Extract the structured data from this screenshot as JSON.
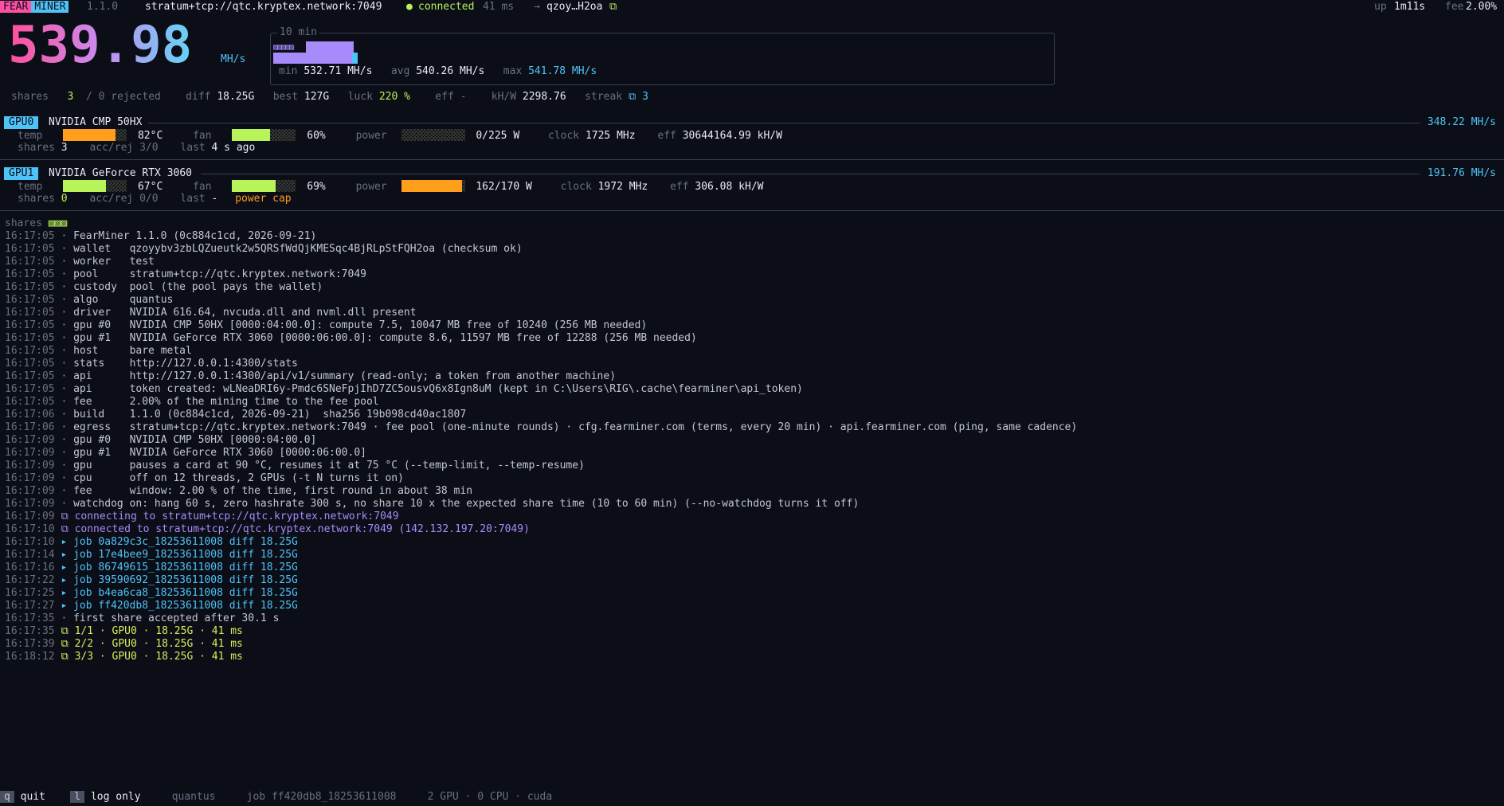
{
  "top": {
    "brand1": "FEAR",
    "brand2": "MINER",
    "version": "1.1.0",
    "pool": "stratum+tcp://qtc.kryptex.network:7049",
    "dot": "●",
    "status": "connected",
    "latency": "41 ms",
    "arrow": "→",
    "wallet_short": "qzoy…H2oa",
    "wallet_icon": "⧉",
    "uptime_label": "up",
    "uptime": "1m11s",
    "fee_label": "fee",
    "fee": "2.00%"
  },
  "hashrate": {
    "value": "539.98",
    "unit": "MH/s"
  },
  "spark": {
    "title": "10 min",
    "chips": "▨▨▨▨▨",
    "chip_end": "▨",
    "min_label": "min",
    "min": "532.71 MH/s",
    "avg_label": "avg",
    "avg": "540.26 MH/s",
    "max_label": "max",
    "max": "541.78 MH/s"
  },
  "summary": {
    "shares_label": "shares",
    "shares": "3",
    "rejected": "/ 0 rejected",
    "diff_label": "diff",
    "diff": "18.25G",
    "best_label": "best",
    "best": "127G",
    "luck_label": "luck",
    "luck": "220 %",
    "eff_label": "eff",
    "eff": "-",
    "khw_label": "kH/W",
    "khw": "2298.76",
    "streak_label": "streak",
    "streak_icon": "⧉",
    "streak": "3"
  },
  "gpus": [
    {
      "tag": "GPU0",
      "name": "NVIDIA CMP 50HX",
      "rate": "348.22 MH/s",
      "temp_label": "temp",
      "temp": "82°C",
      "temp_frac": 0.82,
      "temp_color": "#ff9f1c",
      "fan_label": "fan",
      "fan": "60%",
      "fan_frac": 0.6,
      "fan_color": "#b8f35a",
      "power_label": "power",
      "power": "0/225 W",
      "power_frac": 0.0,
      "power_color": "#ff9f1c",
      "clock_label": "clock",
      "clock": "1725 MHz",
      "eff_label": "eff",
      "eff": "30644164.99 kH/W",
      "shares_label": "shares",
      "shares": "3",
      "accrej_label": "acc/rej",
      "accrej": "3/0",
      "last_label": "last",
      "last": "4 s ago",
      "note": ""
    },
    {
      "tag": "GPU1",
      "name": "NVIDIA GeForce RTX 3060",
      "rate": "191.76 MH/s",
      "temp_label": "temp",
      "temp": "67°C",
      "temp_frac": 0.67,
      "temp_color": "#b8f35a",
      "fan_label": "fan",
      "fan": "69%",
      "fan_frac": 0.69,
      "fan_color": "#b8f35a",
      "power_label": "power",
      "power": "162/170 W",
      "power_frac": 0.95,
      "power_color": "#ff9f1c",
      "clock_label": "clock",
      "clock": "1972 MHz",
      "eff_label": "eff",
      "eff": "306.08 kH/W",
      "shares_label": "shares",
      "shares": "0",
      "accrej_label": "acc/rej",
      "accrej": "0/0",
      "last_label": "last",
      "last": "-",
      "note": "power cap"
    }
  ],
  "shares_strip": {
    "label": "shares",
    "marks": "▨▨▨"
  },
  "log": [
    {
      "t": "16:17:05",
      "s": "·",
      "k": "",
      "v": "FearMiner 1.1.0 (0c884c1cd, 2026-09-21)",
      "c": "#c3c7d3"
    },
    {
      "t": "16:17:05",
      "s": "·",
      "k": "wallet",
      "v": "qzoyybv3zbLQZueutk2w5QRSfWdQjKMESqc4BjRLpStFQH2oa (checksum ok)",
      "c": "#c3c7d3"
    },
    {
      "t": "16:17:05",
      "s": "·",
      "k": "worker",
      "v": "test",
      "c": "#c3c7d3"
    },
    {
      "t": "16:17:05",
      "s": "·",
      "k": "pool",
      "v": "stratum+tcp://qtc.kryptex.network:7049",
      "c": "#c3c7d3"
    },
    {
      "t": "16:17:05",
      "s": "·",
      "k": "custody",
      "v": "pool (the pool pays the wallet)",
      "c": "#c3c7d3"
    },
    {
      "t": "16:17:05",
      "s": "·",
      "k": "algo",
      "v": "quantus",
      "c": "#c3c7d3"
    },
    {
      "t": "16:17:05",
      "s": "·",
      "k": "driver",
      "v": "NVIDIA 616.64, nvcuda.dll and nvml.dll present",
      "c": "#c3c7d3"
    },
    {
      "t": "16:17:05",
      "s": "·",
      "k": "gpu #0",
      "v": "NVIDIA CMP 50HX [0000:04:00.0]: compute 7.5, 10047 MB free of 10240 (256 MB needed)",
      "c": "#c3c7d3"
    },
    {
      "t": "16:17:05",
      "s": "·",
      "k": "gpu #1",
      "v": "NVIDIA GeForce RTX 3060 [0000:06:00.0]: compute 8.6, 11597 MB free of 12288 (256 MB needed)",
      "c": "#c3c7d3"
    },
    {
      "t": "16:17:05",
      "s": "·",
      "k": "host",
      "v": "bare metal",
      "c": "#c3c7d3"
    },
    {
      "t": "16:17:05",
      "s": "·",
      "k": "stats",
      "v": "http://127.0.0.1:4300/stats",
      "c": "#c3c7d3"
    },
    {
      "t": "16:17:05",
      "s": "·",
      "k": "api",
      "v": "http://127.0.0.1:4300/api/v1/summary (read-only; a token from another machine)",
      "c": "#c3c7d3"
    },
    {
      "t": "16:17:05",
      "s": "·",
      "k": "api",
      "v": "token created: wLNeaDRI6y-Pmdc6SNeFpjIhD7ZC5ousvQ6x8Ign8uM (kept in C:\\Users\\RIG\\.cache\\fearminer\\api_token)",
      "c": "#c3c7d3"
    },
    {
      "t": "16:17:05",
      "s": "·",
      "k": "fee",
      "v": "2.00% of the mining time to the fee pool",
      "c": "#c3c7d3"
    },
    {
      "t": "16:17:06",
      "s": "·",
      "k": "build",
      "v": "1.1.0 (0c884c1cd, 2026-09-21)  sha256 19b098cd40ac1807",
      "c": "#c3c7d3"
    },
    {
      "t": "16:17:06",
      "s": "·",
      "k": "egress",
      "v": "stratum+tcp://qtc.kryptex.network:7049 · fee pool (one-minute rounds) · cfg.fearminer.com (terms, every 20 min) · api.fearminer.com (ping, same cadence)",
      "c": "#c3c7d3"
    },
    {
      "t": "16:17:09",
      "s": "·",
      "k": "gpu #0",
      "v": "NVIDIA CMP 50HX [0000:04:00.0]",
      "c": "#c3c7d3"
    },
    {
      "t": "16:17:09",
      "s": "·",
      "k": "gpu #1",
      "v": "NVIDIA GeForce RTX 3060 [0000:06:00.0]",
      "c": "#c3c7d3"
    },
    {
      "t": "16:17:09",
      "s": "·",
      "k": "gpu",
      "v": "pauses a card at 90 °C, resumes it at 75 °C (--temp-limit, --temp-resume)",
      "c": "#c3c7d3"
    },
    {
      "t": "16:17:09",
      "s": "·",
      "k": "cpu",
      "v": "off on 12 threads, 2 GPUs (-t N turns it on)",
      "c": "#c3c7d3"
    },
    {
      "t": "16:17:09",
      "s": "·",
      "k": "fee",
      "v": "window: 2.00 % of the time, first round in about 38 min",
      "c": "#c3c7d3"
    },
    {
      "t": "16:17:09",
      "s": "·",
      "k": "",
      "v": "watchdog on: hang 60 s, zero hashrate 300 s, no share 10 x the expected share time (10 to 60 min) (--no-watchdog turns it off)",
      "c": "#c3c7d3"
    },
    {
      "t": "16:17:09",
      "s": "⧉",
      "k": "",
      "v": "connecting to stratum+tcp://qtc.kryptex.network:7049",
      "c": "#a78bfa"
    },
    {
      "t": "16:17:10",
      "s": "⧉",
      "k": "",
      "v": "connected to stratum+tcp://qtc.kryptex.network:7049 (142.132.197.20:7049)",
      "c": "#a78bfa"
    },
    {
      "t": "16:17:10",
      "s": "▸",
      "k": "",
      "v": "job 0a829c3c_18253611008 diff 18.25G",
      "c": "#4fc3f7"
    },
    {
      "t": "16:17:14",
      "s": "▸",
      "k": "",
      "v": "job 17e4bee9_18253611008 diff 18.25G",
      "c": "#4fc3f7"
    },
    {
      "t": "16:17:16",
      "s": "▸",
      "k": "",
      "v": "job 86749615_18253611008 diff 18.25G",
      "c": "#4fc3f7"
    },
    {
      "t": "16:17:22",
      "s": "▸",
      "k": "",
      "v": "job 39590692_18253611008 diff 18.25G",
      "c": "#4fc3f7"
    },
    {
      "t": "16:17:25",
      "s": "▸",
      "k": "",
      "v": "job b4ea6ca8_18253611008 diff 18.25G",
      "c": "#4fc3f7"
    },
    {
      "t": "16:17:27",
      "s": "▸",
      "k": "",
      "v": "job ff420db8_18253611008 diff 18.25G",
      "c": "#4fc3f7"
    },
    {
      "t": "16:17:35",
      "s": "·",
      "k": "",
      "v": "first share accepted after 30.1 s",
      "c": "#c3c7d3"
    },
    {
      "t": "16:17:35",
      "s": "⧉",
      "k": "",
      "v": "1/1 · GPU0 · 18.25G · 41 ms",
      "c": "#d4f05a"
    },
    {
      "t": "16:17:39",
      "s": "⧉",
      "k": "",
      "v": "2/2 · GPU0 · 18.25G · 41 ms",
      "c": "#d4f05a"
    },
    {
      "t": "16:18:12",
      "s": "⧉",
      "k": "",
      "v": "3/3 · GPU0 · 18.25G · 41 ms",
      "c": "#d4f05a"
    }
  ],
  "footer": {
    "q_key": "q",
    "q_label": "quit",
    "l_key": "l",
    "l_label": "log only",
    "algo": "quantus",
    "job": "job ff420db8_18253611008",
    "devices": "2 GPU · 0 CPU · cuda"
  },
  "colors": {
    "bg": "#0b0d17",
    "accent_pink": "#ff4fa3",
    "accent_cyan": "#4fc3f7",
    "accent_purple": "#a78bfa",
    "green": "#b8f35a",
    "orange": "#ff9f1c"
  }
}
